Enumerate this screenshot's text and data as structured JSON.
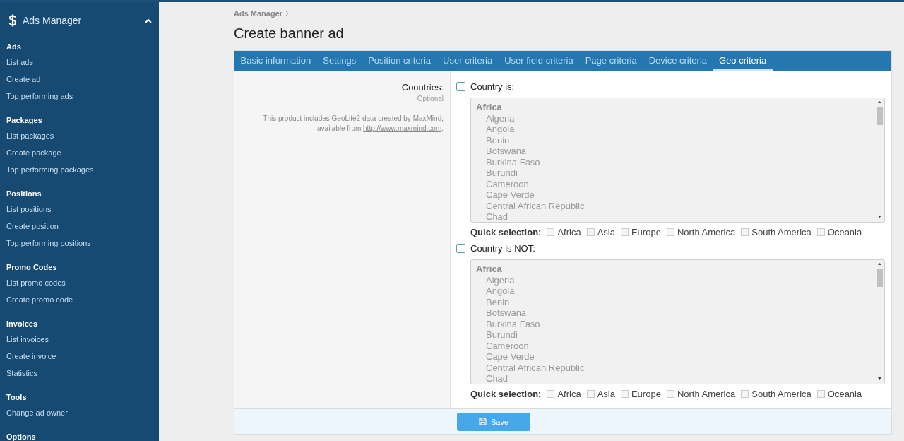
{
  "sidebar": {
    "title": "Ads Manager",
    "expanded": true,
    "sections": [
      {
        "heading": "Ads",
        "items": [
          "List ads",
          "Create ad",
          "Top performing ads"
        ]
      },
      {
        "heading": "Packages",
        "items": [
          "List packages",
          "Create package",
          "Top performing packages"
        ]
      },
      {
        "heading": "Positions",
        "items": [
          "List positions",
          "Create position",
          "Top performing positions"
        ]
      },
      {
        "heading": "Promo Codes",
        "items": [
          "List promo codes",
          "Create promo code"
        ]
      },
      {
        "heading": "Invoices",
        "items": [
          "List invoices",
          "Create invoice",
          "Statistics"
        ]
      },
      {
        "heading": "Tools",
        "items": [
          "Change ad owner"
        ]
      },
      {
        "heading": "Options"
      }
    ]
  },
  "breadcrumb": [
    "Ads Manager"
  ],
  "title": "Create banner ad",
  "tabs": [
    {
      "label": "Basic information",
      "selected": false
    },
    {
      "label": "Settings",
      "selected": false
    },
    {
      "label": "Position criteria",
      "selected": false
    },
    {
      "label": "User criteria",
      "selected": false
    },
    {
      "label": "User field criteria",
      "selected": false
    },
    {
      "label": "Page criteria",
      "selected": false
    },
    {
      "label": "Device criteria",
      "selected": false
    },
    {
      "label": "Geo criteria",
      "selected": true
    }
  ],
  "form": {
    "label": "Countries:",
    "hint": "Optional",
    "note": "This product includes GeoLite2 data created by MaxMind, available from",
    "note_link": "http://www.maxmind.com",
    "note_end": ".",
    "criteria": [
      {
        "label": "Country is:",
        "checked": false,
        "group": "Africa",
        "countries": [
          "Algeria",
          "Angola",
          "Benin",
          "Botswana",
          "Burkina Faso",
          "Burundi",
          "Cameroon",
          "Cape Verde",
          "Central African Republic",
          "Chad"
        ],
        "quick_label": "Quick selection:",
        "quick": [
          {
            "label": "Africa",
            "checked": false
          },
          {
            "label": "Asia",
            "checked": false
          },
          {
            "label": "Europe",
            "checked": false
          },
          {
            "label": "North America",
            "checked": false
          },
          {
            "label": "South America",
            "checked": false
          },
          {
            "label": "Oceania",
            "checked": false
          }
        ]
      },
      {
        "label": "Country is NOT:",
        "checked": false,
        "group": "Africa",
        "countries": [
          "Algeria",
          "Angola",
          "Benin",
          "Botswana",
          "Burkina Faso",
          "Burundi",
          "Cameroon",
          "Cape Verde",
          "Central African Republic",
          "Chad"
        ],
        "quick_label": "Quick selection:",
        "quick": [
          {
            "label": "Africa",
            "checked": false
          },
          {
            "label": "Asia",
            "checked": false
          },
          {
            "label": "Europe",
            "checked": false
          },
          {
            "label": "North America",
            "checked": false
          },
          {
            "label": "South America",
            "checked": false
          },
          {
            "label": "Oceania",
            "checked": false
          }
        ]
      }
    ]
  },
  "save_button": "Save"
}
